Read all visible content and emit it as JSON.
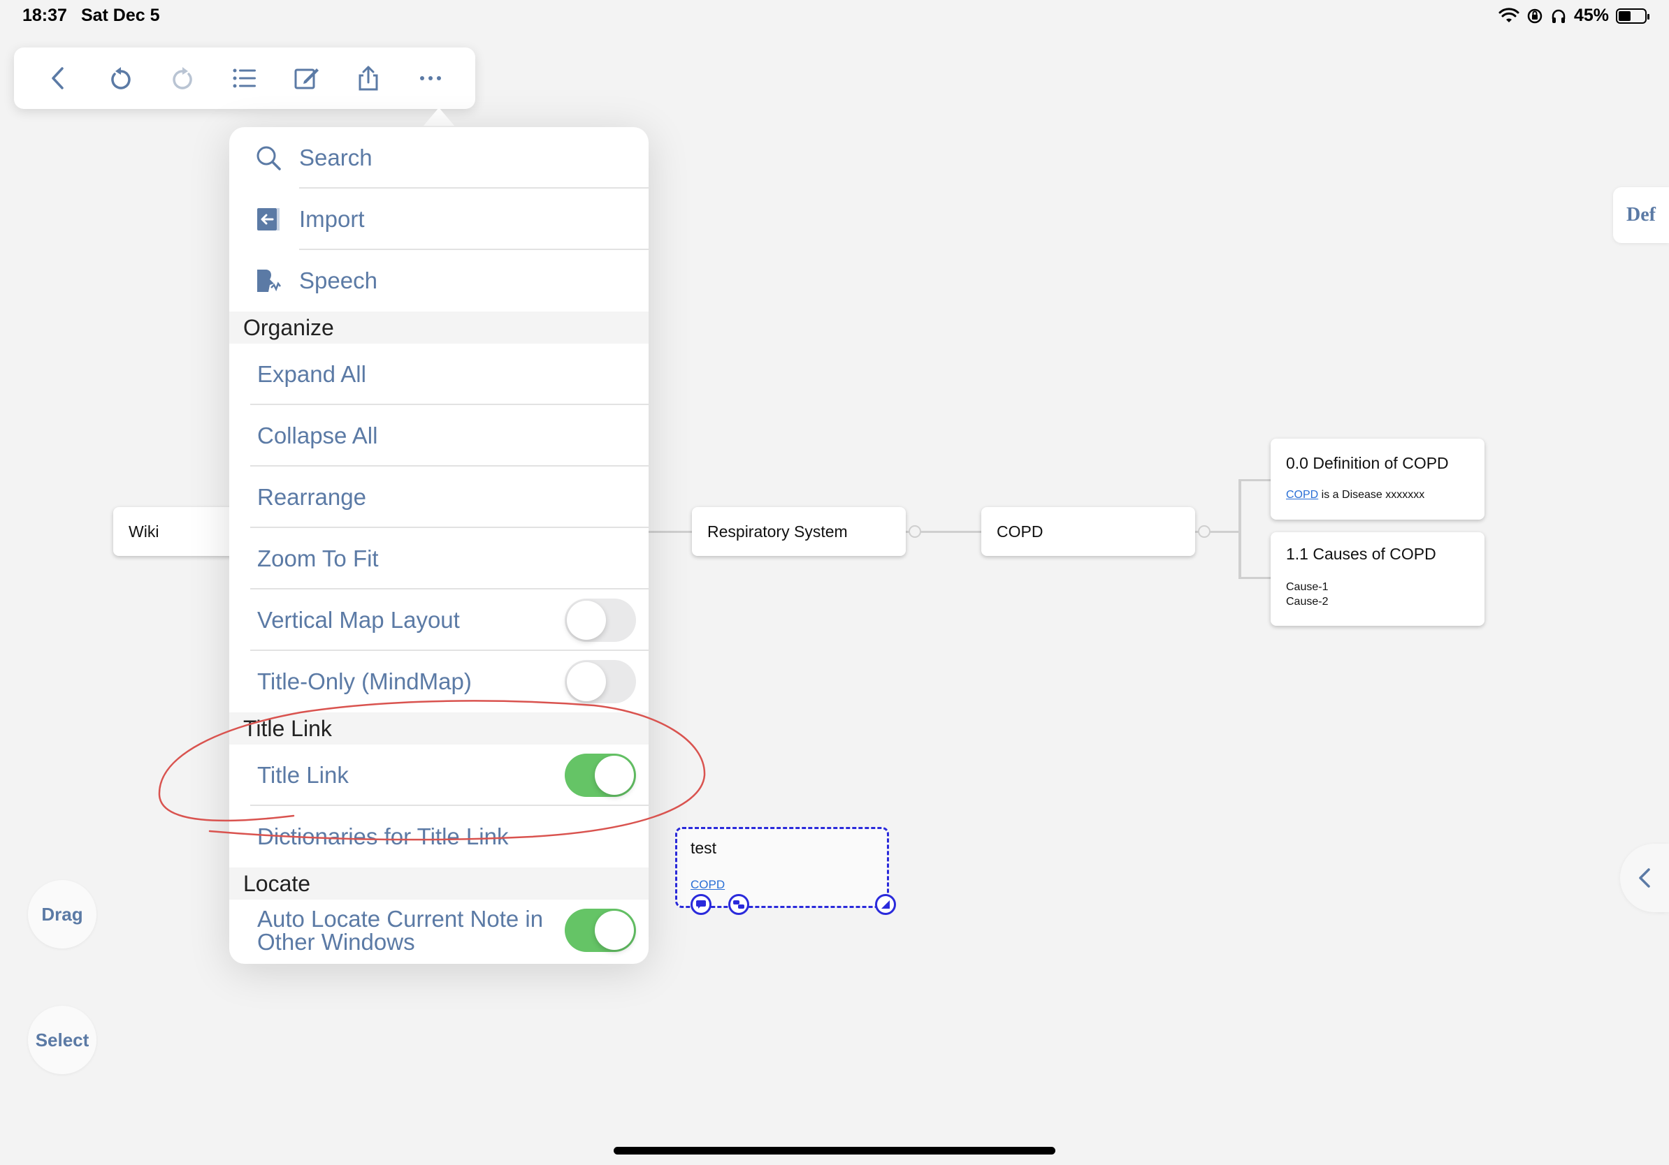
{
  "status_bar": {
    "time": "18:37",
    "date": "Sat Dec 5",
    "battery": "45%"
  },
  "toolbar": {
    "icons": [
      "back-icon",
      "undo-icon",
      "redo-icon",
      "list-icon",
      "edit-icon",
      "share-icon",
      "more-icon"
    ]
  },
  "menu": {
    "search": "Search",
    "import": "Import",
    "speech": "Speech",
    "organize_header": "Organize",
    "expand_all": "Expand All",
    "collapse_all": "Collapse All",
    "rearrange": "Rearrange",
    "zoom_to_fit": "Zoom To Fit",
    "vertical_map_layout": "Vertical Map Layout",
    "title_only": "Title-Only (MindMap)",
    "title_link_header": "Title Link",
    "title_link": "Title Link",
    "dictionaries": "Dictionaries for Title Link",
    "locate_header": "Locate",
    "auto_locate": "Auto Locate Current Note in Other Windows",
    "toggles": {
      "vertical_map_layout": false,
      "title_only": false,
      "title_link": true,
      "auto_locate": true
    }
  },
  "map": {
    "wiki": "Wiki",
    "respiratory": "Respiratory System",
    "copd": "COPD",
    "definition_title": "0.0 Definition of COPD",
    "definition_link": "COPD",
    "definition_text": " is a Disease xxxxxxx",
    "causes_title": "1.1 Causes of COPD",
    "cause1": "Cause-1",
    "cause2": "Cause-2",
    "test_title": "test",
    "test_link": "COPD"
  },
  "side": {
    "drag": "Drag",
    "select": "Select",
    "def": "Def"
  },
  "colors": {
    "accent": "#5b7aa5",
    "toggle_on": "#65c466",
    "selection": "#2a2adb",
    "annotation": "#d9534f"
  }
}
